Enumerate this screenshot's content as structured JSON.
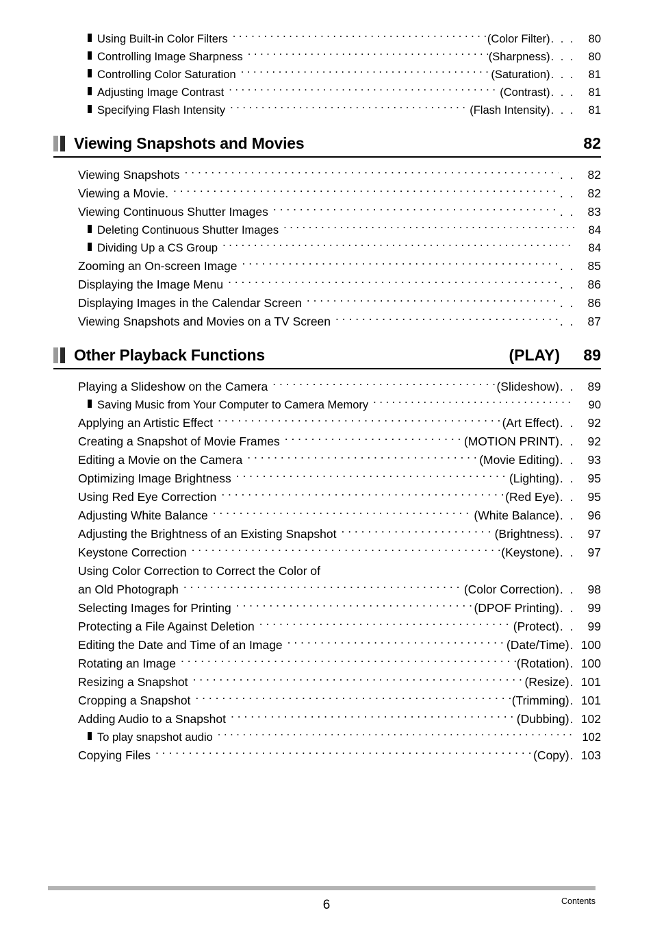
{
  "document": {
    "footer_page_number": "6",
    "footer_label": "Contents"
  },
  "top_group": {
    "entries": [
      {
        "title": "Using Built-in Color Filters",
        "paren": "(Color Filter)",
        "dots": ". . .",
        "page": "80"
      },
      {
        "title": "Controlling Image Sharpness",
        "paren": "(Sharpness)",
        "dots": ". . .",
        "page": "80"
      },
      {
        "title": "Controlling Color Saturation",
        "paren": "(Saturation)",
        "dots": ". . .",
        "page": "81"
      },
      {
        "title": "Adjusting Image Contrast",
        "paren": "(Contrast)",
        "dots": ". . .",
        "page": "81"
      },
      {
        "title": "Specifying Flash Intensity",
        "paren": "(Flash Intensity)",
        "dots": ". . .",
        "page": "81"
      }
    ]
  },
  "sections": [
    {
      "title": "Viewing Snapshots and Movies",
      "tag": "",
      "page": "82",
      "entries": [
        {
          "level": 0,
          "title": "Viewing Snapshots",
          "paren": "",
          "dots": ". .",
          "page": "82"
        },
        {
          "level": 0,
          "title": "Viewing a Movie.",
          "paren": "",
          "dots": ". .",
          "page": "82"
        },
        {
          "level": 0,
          "title": "Viewing Continuous Shutter Images",
          "paren": "",
          "dots": ". .",
          "page": "83"
        },
        {
          "level": 1,
          "title": "Deleting Continuous Shutter Images",
          "paren": "",
          "dots": "",
          "page": "84"
        },
        {
          "level": 1,
          "title": "Dividing Up a CS Group",
          "paren": "",
          "dots": "",
          "page": "84"
        },
        {
          "level": 0,
          "title": "Zooming an On-screen Image",
          "paren": "",
          "dots": ". .",
          "page": "85"
        },
        {
          "level": 0,
          "title": "Displaying the Image Menu",
          "paren": "",
          "dots": ". .",
          "page": "86"
        },
        {
          "level": 0,
          "title": "Displaying Images in the Calendar Screen",
          "paren": "",
          "dots": ". .",
          "page": "86"
        },
        {
          "level": 0,
          "title": "Viewing Snapshots and Movies on a TV Screen",
          "paren": "",
          "dots": ". .",
          "page": "87"
        }
      ]
    },
    {
      "title": "Other Playback Functions",
      "tag": "(PLAY)",
      "page": "89",
      "entries": [
        {
          "level": 0,
          "title": "Playing a Slideshow on the Camera",
          "paren": "(Slideshow)",
          "dots": ". .",
          "page": "89"
        },
        {
          "level": 1,
          "title": "Saving Music from Your Computer to Camera Memory",
          "paren": "",
          "dots": "",
          "page": "90"
        },
        {
          "level": 0,
          "title": "Applying an Artistic Effect",
          "paren": "(Art Effect)",
          "dots": ". .",
          "page": "92"
        },
        {
          "level": 0,
          "title": "Creating a Snapshot of Movie Frames",
          "paren": "(MOTION PRINT)",
          "dots": ". .",
          "page": "92"
        },
        {
          "level": 0,
          "title": "Editing a Movie on the Camera",
          "paren": "(Movie Editing)",
          "dots": ". .",
          "page": "93"
        },
        {
          "level": 0,
          "title": "Optimizing Image Brightness",
          "paren": "(Lighting)",
          "dots": ". .",
          "page": "95"
        },
        {
          "level": 0,
          "title": "Using Red Eye Correction",
          "paren": "(Red Eye)",
          "dots": ". .",
          "page": "95"
        },
        {
          "level": 0,
          "title": "Adjusting White Balance",
          "paren": "(White Balance)",
          "dots": ". .",
          "page": "96"
        },
        {
          "level": 0,
          "title": "Adjusting the Brightness of an Existing Snapshot",
          "paren": "(Brightness)",
          "dots": ". .",
          "page": "97"
        },
        {
          "level": 0,
          "title": "Keystone Correction",
          "paren": "(Keystone)",
          "dots": ". .",
          "page": "97"
        },
        {
          "level": 0,
          "continuation": true,
          "title": "Using Color Correction to Correct the Color of",
          "paren": "",
          "dots": "",
          "page": ""
        },
        {
          "level": 0,
          "title": "an Old Photograph",
          "paren": "(Color Correction)",
          "dots": ". .",
          "page": "98"
        },
        {
          "level": 0,
          "title": "Selecting Images for Printing",
          "paren": "(DPOF Printing)",
          "dots": ". .",
          "page": "99"
        },
        {
          "level": 0,
          "title": "Protecting a File Against Deletion",
          "paren": "(Protect)",
          "dots": ". .",
          "page": "99"
        },
        {
          "level": 0,
          "title": "Editing the Date and Time of an Image",
          "paren": "(Date/Time)",
          "dots": ".",
          "page": "100"
        },
        {
          "level": 0,
          "title": "Rotating an Image",
          "paren": "(Rotation)",
          "dots": ".",
          "page": "100"
        },
        {
          "level": 0,
          "title": "Resizing a Snapshot",
          "paren": "(Resize)",
          "dots": ".",
          "page": "101"
        },
        {
          "level": 0,
          "title": "Cropping a Snapshot",
          "paren": "(Trimming)",
          "dots": ".",
          "page": "101"
        },
        {
          "level": 0,
          "title": "Adding Audio to a Snapshot",
          "paren": "(Dubbing)",
          "dots": ".",
          "page": "102"
        },
        {
          "level": 1,
          "title": "To play snapshot audio",
          "paren": "",
          "dots": "",
          "page": "102"
        },
        {
          "level": 0,
          "title": "Copying Files",
          "paren": "(Copy)",
          "dots": ".",
          "page": "103"
        }
      ]
    }
  ]
}
